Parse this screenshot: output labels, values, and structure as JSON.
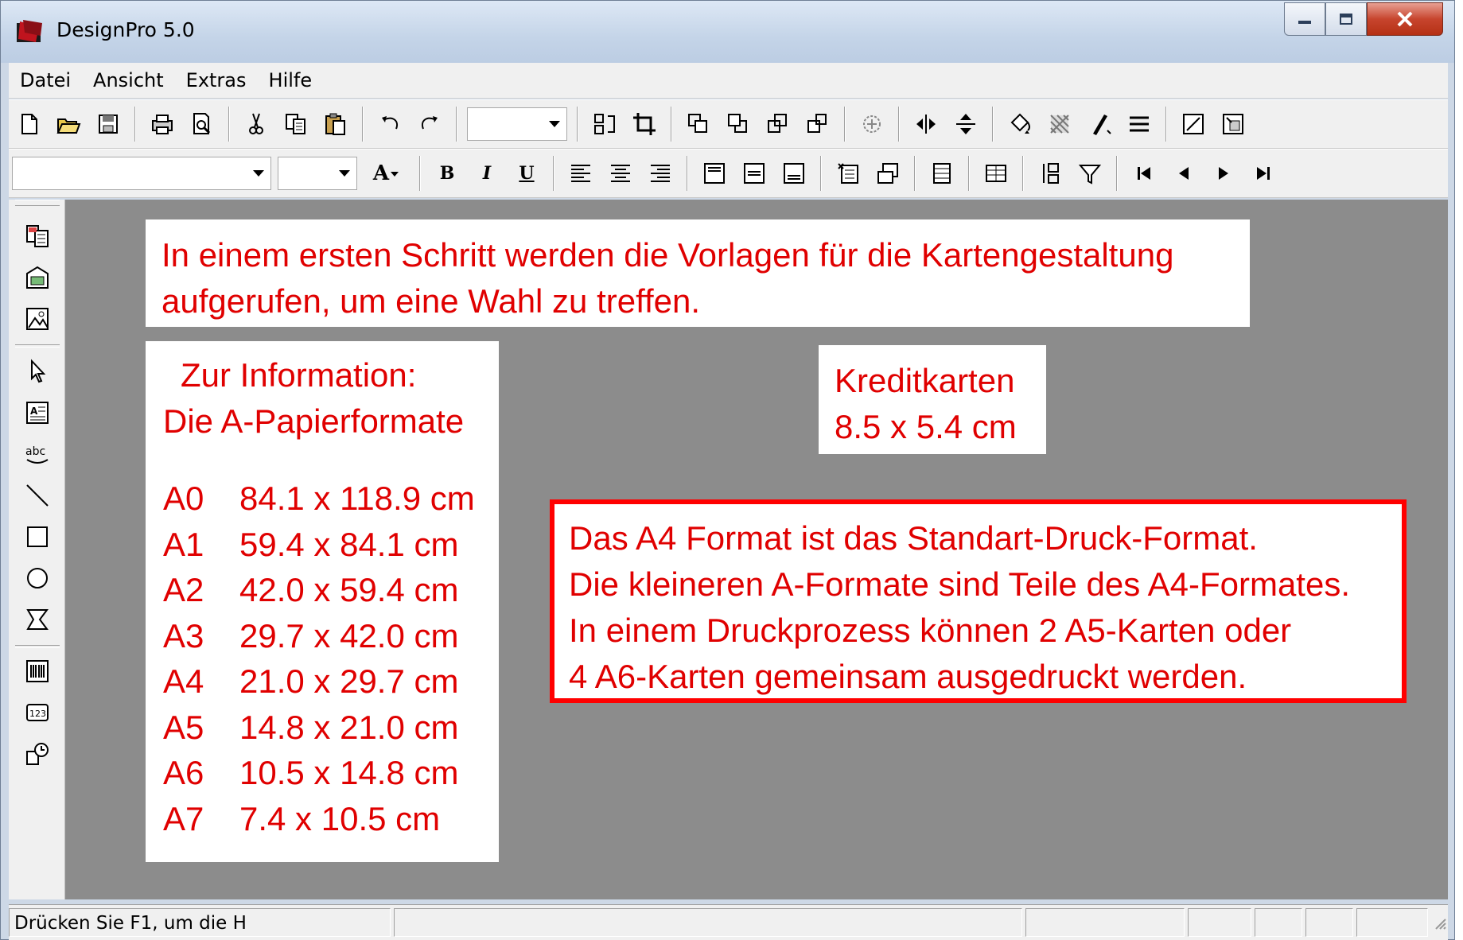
{
  "window": {
    "title": "DesignPro 5.0",
    "controls": [
      "minimize-icon",
      "maximize-icon",
      "close-icon"
    ]
  },
  "menubar": {
    "items": [
      "Datei",
      "Ansicht",
      "Extras",
      "Hilfe"
    ]
  },
  "toolbar1": {
    "icons": [
      "new-icon",
      "open-icon",
      "save-icon",
      "print-icon",
      "print-preview-icon",
      "cut-icon",
      "copy-icon",
      "paste-icon",
      "undo-icon",
      "redo-icon",
      "zoom-combo",
      "layer-order-icon",
      "crop-icon",
      "bring-front-icon",
      "send-back-icon",
      "group-icon",
      "ungroup-icon",
      "rotate-icon",
      "flip-horizontal-icon",
      "flip-vertical-icon",
      "fill-color-icon",
      "pattern-icon",
      "line-color-icon",
      "line-style-icon",
      "resize-icon",
      "fit-icon"
    ]
  },
  "toolbar2": {
    "font_value": "",
    "size_value": "",
    "font_color_glyph": "A",
    "bold": "B",
    "italic": "I",
    "underline": "U",
    "icons": [
      "align-left-icon",
      "align-center-icon",
      "align-right-icon",
      "valign-top-icon",
      "valign-middle-icon",
      "valign-bottom-icon",
      "insert-field-icon",
      "merge-icon",
      "database-icon",
      "table-icon",
      "sort-icon",
      "filter-icon",
      "first-record-icon",
      "previous-record-icon",
      "next-record-icon",
      "last-record-icon"
    ]
  },
  "palette": {
    "icons": [
      "templates-icon",
      "layout-icon",
      "image-icon",
      "pointer-icon",
      "text-box-icon",
      "text-spell-icon",
      "line-icon",
      "rectangle-icon",
      "ellipse-icon",
      "polygon-icon",
      "barcode-icon",
      "number-field-icon",
      "sequence-icon"
    ]
  },
  "notes": {
    "intro_line1": "In einem ersten Schritt werden die Vorlagen für die Kartengestaltung",
    "intro_line2": "aufgerufen, um eine Wahl zu treffen.",
    "info_title1": "Zur Information:",
    "info_title2": "Die A-Papierformate",
    "formats": [
      {
        "code": "A0",
        "size": "84.1 x 118.9 cm"
      },
      {
        "code": "A1",
        "size": "59.4 x 84.1 cm"
      },
      {
        "code": "A2",
        "size": "42.0 x 59.4 cm"
      },
      {
        "code": "A3",
        "size": "29.7 x 42.0 cm"
      },
      {
        "code": "A4",
        "size": "21.0 x 29.7 cm"
      },
      {
        "code": "A5",
        "size": "14.8 x 21.0 cm"
      },
      {
        "code": "A6",
        "size": "10.5 x 14.8 cm"
      },
      {
        "code": "A7",
        "size": "7.4 x 10.5 cm"
      }
    ],
    "credit_line1": "Kreditkarten",
    "credit_line2": "8.5 x 5.4 cm",
    "a4_line1": "Das A4 Format ist das Standart-Druck-Format.",
    "a4_line2": "Die kleineren A-Formate sind Teile des A4-Formates.",
    "a4_line3": "In einem Druckprozess können 2 A5-Karten oder",
    "a4_line4": "4 A6-Karten gemeinsam ausgedruckt werden."
  },
  "statusbar": {
    "text": "Drücken Sie F1, um die H"
  },
  "colors": {
    "note_text": "#e00000",
    "note_border": "#ff0000",
    "canvas": "#8c8c8c"
  }
}
